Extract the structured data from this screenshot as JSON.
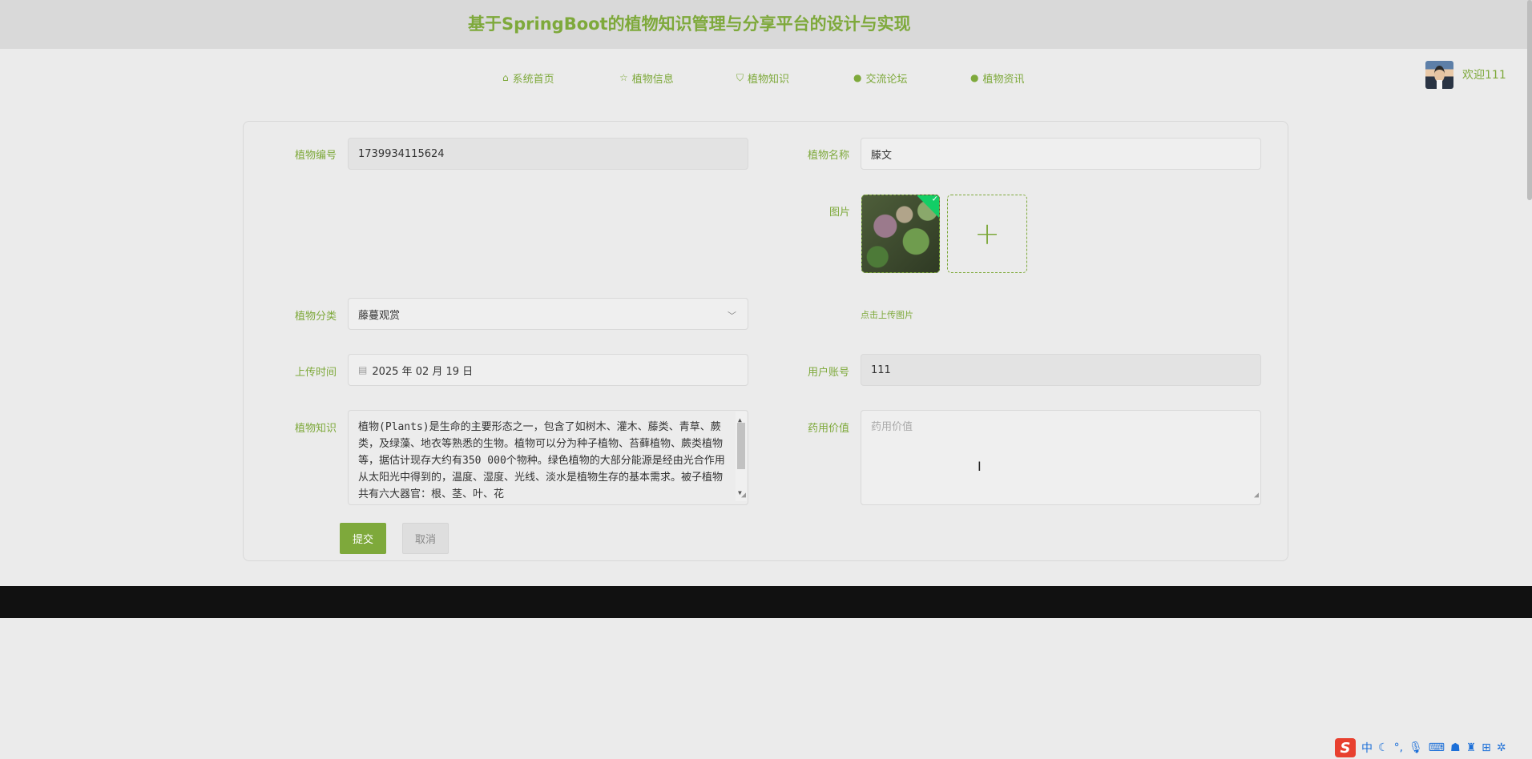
{
  "header": {
    "title": "基于SpringBoot的植物知识管理与分享平台的设计与实现"
  },
  "nav": {
    "items": [
      {
        "label": "系统首页",
        "icon": "home-icon"
      },
      {
        "label": "植物信息",
        "icon": "star-icon"
      },
      {
        "label": "植物知识",
        "icon": "bag-icon"
      },
      {
        "label": "交流论坛",
        "icon": "info-circle-icon"
      },
      {
        "label": "植物资讯",
        "icon": "question-circle-icon"
      }
    ],
    "welcome": "欢迎111"
  },
  "form": {
    "plant_no_label": "植物编号",
    "plant_no_value": "1739934115624",
    "plant_name_label": "植物名称",
    "plant_name_value": "滕文",
    "image_label": "图片",
    "upload_tip": "点击上传图片",
    "category_label": "植物分类",
    "category_value": "藤蔓观赏",
    "upload_time_label": "上传时间",
    "upload_time_value": "2025 年 02 月 19 日",
    "account_label": "用户账号",
    "account_value": "111",
    "knowledge_label": "植物知识",
    "knowledge_value": "植物(Plants)是生命的主要形态之一，包含了如树木、灌木、藤类、青草、蕨类，及绿藻、地衣等熟悉的生物。植物可以分为种子植物、苔藓植物、蕨类植物等，据估计现存大约有350 000个物种。绿色植物的大部分能源是经由光合作用从太阳光中得到的，温度、湿度、光线、淡水是植物生存的基本需求。被子植物共有六大器官：根、茎、叶、花",
    "medicinal_label": "药用价值",
    "medicinal_placeholder": "药用价值",
    "submit_label": "提交",
    "cancel_label": "取消"
  },
  "accent_color": "#7ea93b",
  "tray": {
    "ime_label": "中"
  }
}
